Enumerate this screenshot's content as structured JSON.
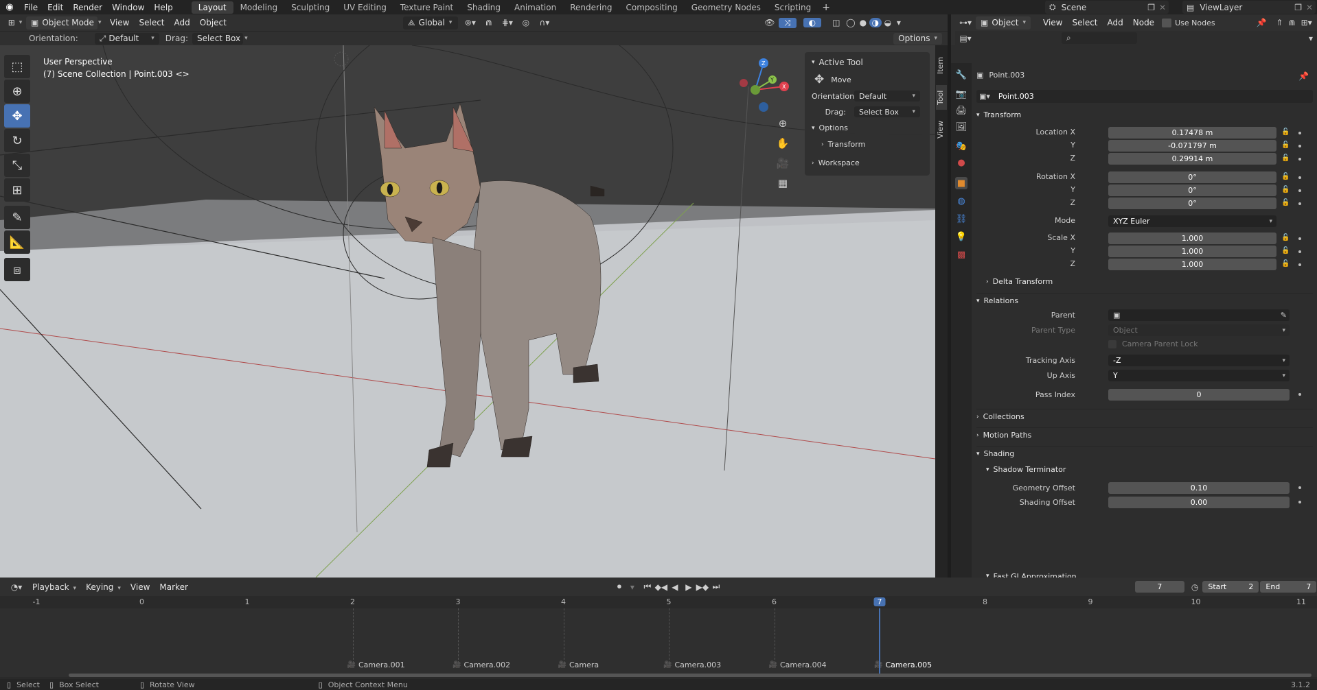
{
  "top_menu": [
    "File",
    "Edit",
    "Render",
    "Window",
    "Help"
  ],
  "workspaces": [
    "Layout",
    "Modeling",
    "Sculpting",
    "UV Editing",
    "Texture Paint",
    "Shading",
    "Animation",
    "Rendering",
    "Compositing",
    "Geometry Nodes",
    "Scripting"
  ],
  "scene_name": "Scene",
  "view_layer": "ViewLayer",
  "viewport_header": {
    "mode": "Object Mode",
    "menus": [
      "View",
      "Select",
      "Add",
      "Object"
    ],
    "transform_orientation": "Global",
    "options": "Options"
  },
  "tool_settings": {
    "orientation_label": "Orientation:",
    "orientation_value": "Default",
    "drag_label": "Drag:",
    "drag_value": "Select Box"
  },
  "viewport": {
    "perspective": "User Perspective",
    "collection_info": "(7) Scene Collection | Point.003 <>"
  },
  "n_panel": {
    "active_tool": "Active Tool",
    "tool_name": "Move",
    "orientation_label": "Orientation",
    "orientation_value": "Default",
    "drag_label": "Drag:",
    "drag_value": "Select Box",
    "options": "Options",
    "transform": "Transform",
    "workspace": "Workspace"
  },
  "side_tabs": [
    "Item",
    "Tool",
    "View"
  ],
  "node_header": {
    "type": "Object",
    "menus": [
      "View",
      "Select",
      "Add",
      "Node"
    ],
    "use_nodes": "Use Nodes"
  },
  "properties": {
    "object_name": "Point.003",
    "data_name": "Point.003",
    "transform": "Transform",
    "location_x_label": "Location X",
    "location_x": "0.17478 m",
    "location_y_label": "Y",
    "location_y": "-0.071797 m",
    "location_z_label": "Z",
    "location_z": "0.29914 m",
    "rotation_x_label": "Rotation X",
    "rotation_x": "0°",
    "rotation_y_label": "Y",
    "rotation_y": "0°",
    "rotation_z_label": "Z",
    "rotation_z": "0°",
    "mode_label": "Mode",
    "mode": "XYZ Euler",
    "scale_x_label": "Scale X",
    "scale_x": "1.000",
    "scale_y_label": "Y",
    "scale_y": "1.000",
    "scale_z_label": "Z",
    "scale_z": "1.000",
    "delta_transform": "Delta Transform",
    "relations": "Relations",
    "parent_label": "Parent",
    "parent_type_label": "Parent Type",
    "parent_type": "Object",
    "camera_parent_lock": "Camera Parent Lock",
    "tracking_axis_label": "Tracking Axis",
    "tracking_axis": "-Z",
    "up_axis_label": "Up Axis",
    "up_axis": "Y",
    "pass_index_label": "Pass Index",
    "pass_index": "0",
    "collections": "Collections",
    "motion_paths": "Motion Paths",
    "shading": "Shading",
    "shadow_terminator": "Shadow Terminator",
    "geometry_offset_label": "Geometry Offset",
    "geometry_offset": "0.10",
    "shading_offset_label": "Shading Offset",
    "shading_offset": "0.00",
    "fast_gi": "Fast GI Approximation"
  },
  "timeline": {
    "menus": [
      "Playback",
      "Keying",
      "View",
      "Marker"
    ],
    "current_frame": "7",
    "start_label": "Start",
    "start": "2",
    "end_label": "End",
    "end": "7",
    "frame_numbers": [
      "-1",
      "0",
      "1",
      "2",
      "3",
      "4",
      "5",
      "6",
      "7",
      "8",
      "9",
      "10",
      "11"
    ],
    "markers": [
      {
        "label": "Camera.001",
        "frame": 2
      },
      {
        "label": "Camera.002",
        "frame": 3
      },
      {
        "label": "Camera",
        "frame": 4
      },
      {
        "label": "Camera.003",
        "frame": 5
      },
      {
        "label": "Camera.004",
        "frame": 6
      },
      {
        "label": "Camera.005",
        "frame": 7
      }
    ]
  },
  "status_bar": {
    "select": "Select",
    "box_select": "Box Select",
    "rotate_view": "Rotate View",
    "context_menu": "Object Context Menu",
    "version": "3.1.2"
  },
  "colors": {
    "accent": "#4772b3",
    "x_axis": "#e0404e",
    "y_axis": "#8bc34a",
    "z_axis": "#3d82e0"
  }
}
